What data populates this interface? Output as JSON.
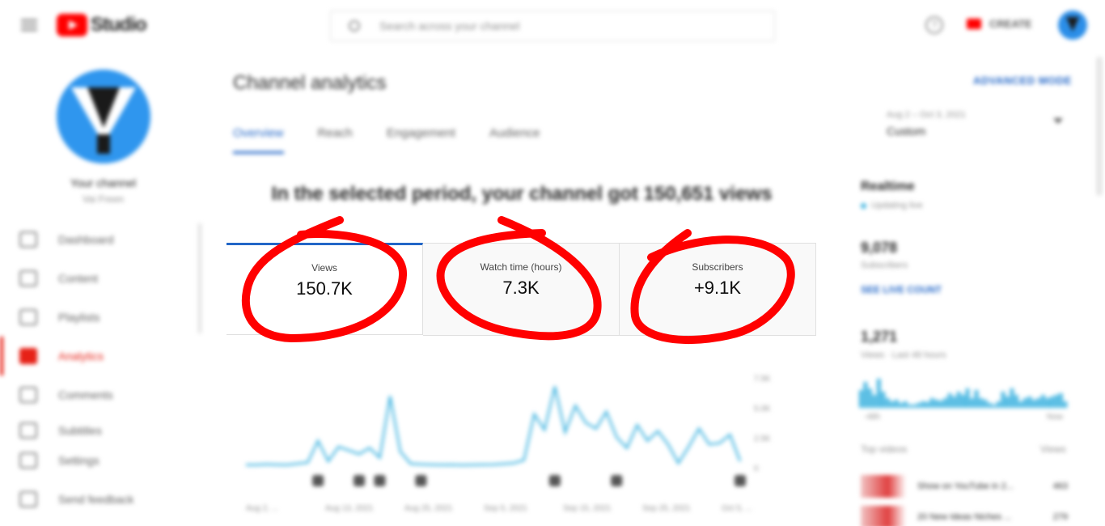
{
  "header": {
    "logo_text": "Studio",
    "search_placeholder": "Search across your channel",
    "help_label": "?",
    "create_label": "CREATE"
  },
  "sidebar": {
    "channel_name": "Your channel",
    "channel_sub": "Vai Freen",
    "items": [
      {
        "label": "Dashboard",
        "icon": "dashboard-icon"
      },
      {
        "label": "Content",
        "icon": "content-icon"
      },
      {
        "label": "Playlists",
        "icon": "playlists-icon"
      },
      {
        "label": "Analytics",
        "icon": "analytics-icon",
        "active": true
      },
      {
        "label": "Comments",
        "icon": "comments-icon"
      },
      {
        "label": "Subtitles",
        "icon": "subtitles-icon"
      },
      {
        "label": "Settings",
        "icon": "settings-icon"
      },
      {
        "label": "Send feedback",
        "icon": "feedback-icon"
      }
    ]
  },
  "main": {
    "title": "Channel analytics",
    "advanced_mode": "ADVANCED MODE",
    "tabs": [
      "Overview",
      "Reach",
      "Engagement",
      "Audience"
    ],
    "headline": "In the selected period, your channel got 150,651 views",
    "metrics": [
      {
        "label": "Views",
        "value": "150.7K"
      },
      {
        "label": "Watch time (hours)",
        "value": "7.3K"
      },
      {
        "label": "Subscribers",
        "value": "+9.1K"
      }
    ]
  },
  "chart_data": {
    "type": "line",
    "x": [
      "Aug 2, ...",
      "Aug 13, 2021",
      "Aug 25, 2021",
      "Sep 5, 2021",
      "Sep 15, 2021",
      "Sep 25, 2021",
      "Oct 5, ..."
    ],
    "yticks": [
      "7.5K",
      "5.0K",
      "2.5K",
      "0"
    ],
    "ylim": [
      0,
      7500
    ],
    "values": [
      300,
      300,
      350,
      320,
      300,
      400,
      500,
      2300,
      600,
      1800,
      1500,
      1200,
      1700,
      900,
      6000,
      1400,
      400,
      350,
      320,
      300,
      310,
      290,
      300,
      320,
      330,
      380,
      450,
      700,
      4500,
      3200,
      6800,
      3000,
      5200,
      3800,
      3300,
      4700,
      2600,
      1700,
      3600,
      2300,
      3100,
      2000,
      450,
      1800,
      3300,
      2000,
      2100,
      2800,
      600
    ],
    "color": "#41b4e0"
  },
  "right_panel": {
    "date_range_sub": "Aug 2 – Oct 3, 2021",
    "date_range_val": "Custom",
    "realtime_title": "Realtime",
    "realtime_live": "Updating live",
    "subs_value": "9,078",
    "subs_label": "Subscribers",
    "live_count_link": "SEE LIVE COUNT",
    "views_value": "1,271",
    "views_label": "Views · Last 48 hours",
    "mini_bars": [
      0.55,
      0.8,
      0.6,
      0.4,
      0.9,
      0.5,
      0.3,
      0.2,
      0.25,
      0.15,
      0.2,
      0.1,
      0.1,
      0.15,
      0.2,
      0.18,
      0.3,
      0.25,
      0.22,
      0.3,
      0.45,
      0.35,
      0.5,
      0.4,
      0.6,
      0.3,
      0.55,
      0.3,
      0.25,
      0.15,
      0.1,
      0.2,
      0.5,
      0.35,
      0.6,
      0.4,
      0.2,
      0.3,
      0.35,
      0.25,
      0.3,
      0.4,
      0.3,
      0.35,
      0.4,
      0.45,
      0.2
    ],
    "mini_axis_left": "-48h",
    "mini_axis_right": "Now",
    "top_videos_label": "Top videos",
    "views_header": "Views",
    "videos": [
      {
        "title": "Show on YouTube in 2...",
        "views": "463"
      },
      {
        "title": "20 New Ideas Niches ...",
        "views": "279"
      }
    ]
  }
}
